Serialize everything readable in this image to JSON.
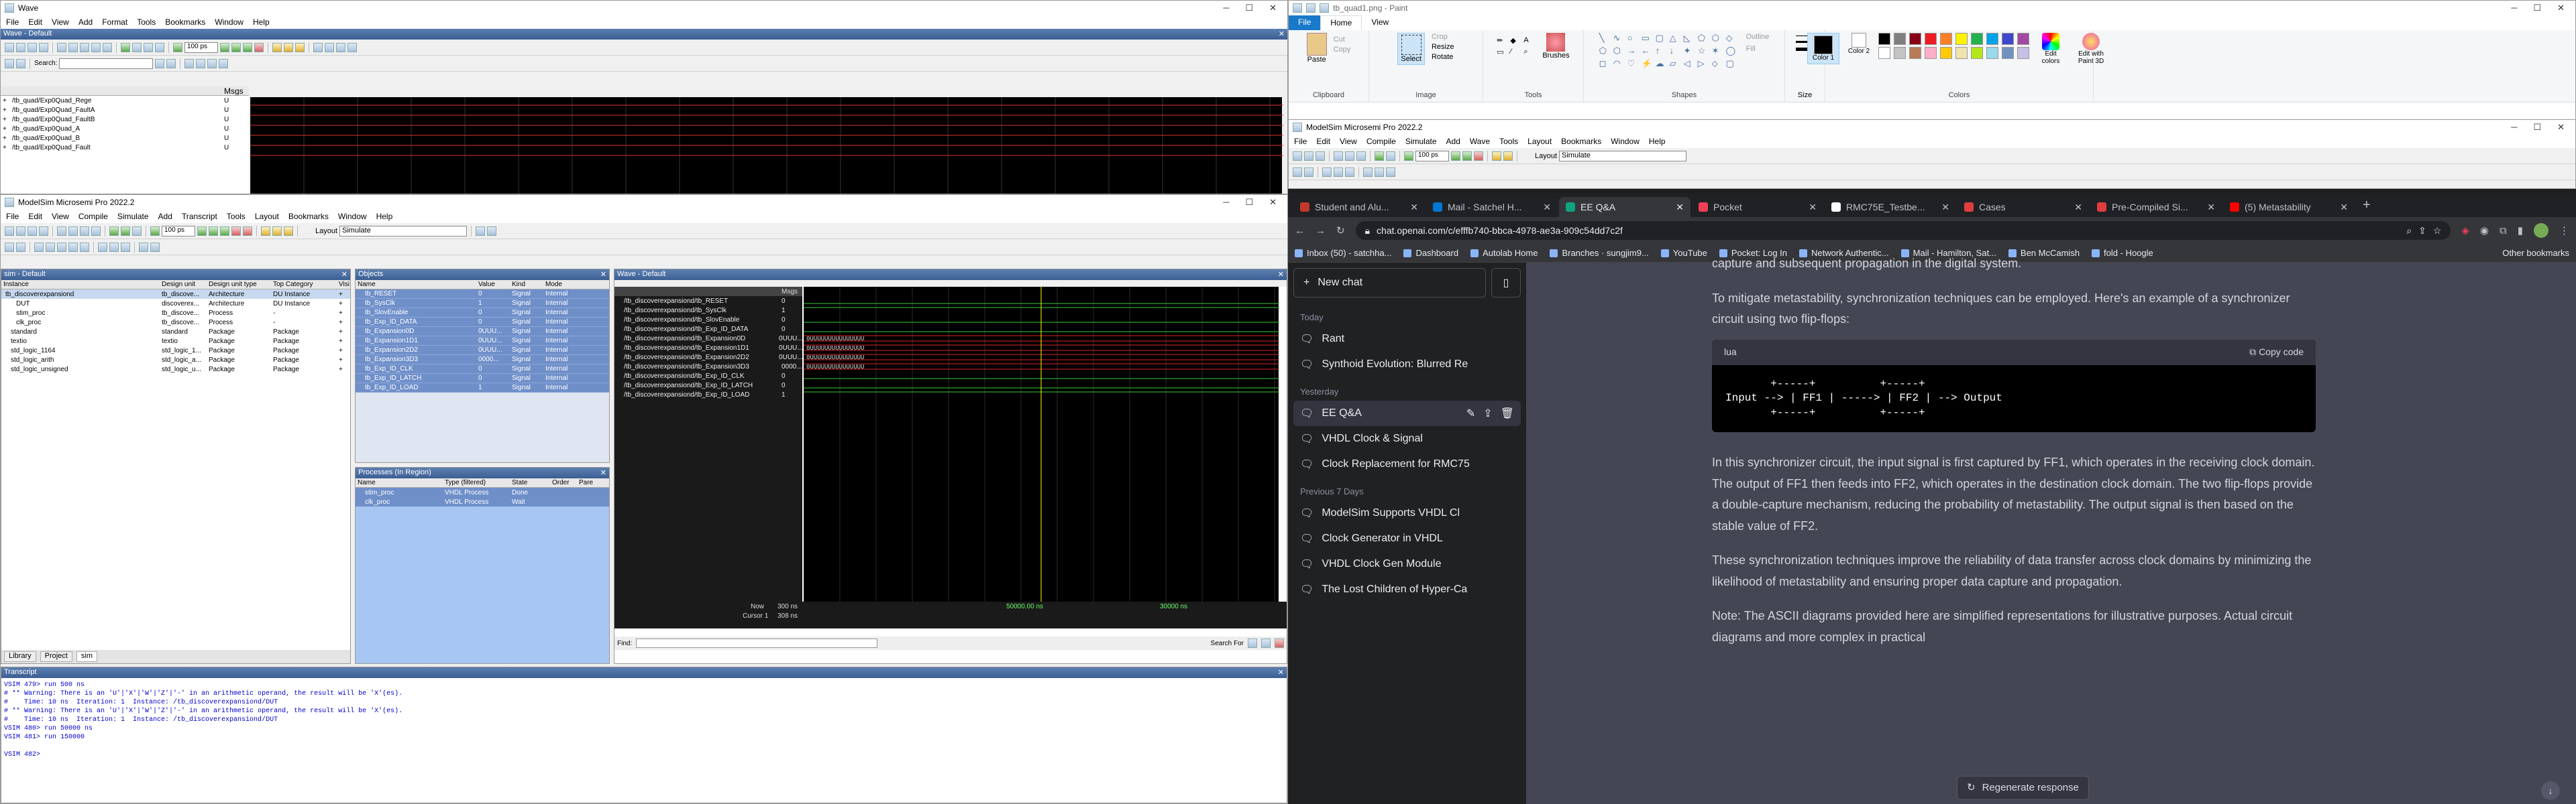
{
  "wave_window": {
    "title": "Wave",
    "menu": [
      "File",
      "Edit",
      "View",
      "Add",
      "Format",
      "Tools",
      "Bookmarks",
      "Window",
      "Help"
    ],
    "panel_title": "Wave - Default",
    "search_label": "Search:",
    "msgs_header": "Msgs",
    "signals": [
      {
        "name": "/tb_quad/Exp0Quad_Rege",
        "value": "U"
      },
      {
        "name": "/tb_quad/Exp0Quad_FaultA",
        "value": "U"
      },
      {
        "name": "/tb_quad/Exp0Quad_FaultB",
        "value": "U"
      },
      {
        "name": "/tb_quad/Exp0Quad_A",
        "value": "U"
      },
      {
        "name": "/tb_quad/Exp0Quad_B",
        "value": "U"
      },
      {
        "name": "/tb_quad/Exp0Quad_Fault",
        "value": "U"
      }
    ],
    "zoom_value": "100 ps"
  },
  "modelsim_left": {
    "title": "ModelSim Microsemi Pro 2022.2",
    "menu": [
      "File",
      "Edit",
      "View",
      "Compile",
      "Simulate",
      "Add",
      "Transcript",
      "Tools",
      "Layout",
      "Bookmarks",
      "Window",
      "Help"
    ],
    "layout_label": "Layout",
    "layout_value": "Simulate",
    "zoom_value": "100 ps",
    "sim_panel": {
      "title": "sim - Default",
      "columns": [
        "Instance",
        "Design unit",
        "Design unit type",
        "Top Category",
        "Visi"
      ],
      "rows": [
        [
          "tb_discoverexpansiond",
          "tb_discove...",
          "Architecture",
          "DU Instance",
          "+"
        ],
        [
          "DUT",
          "discoverex...",
          "Architecture",
          "DU Instance",
          "+"
        ],
        [
          "stim_proc",
          "tb_discove...",
          "Process",
          "-",
          "+"
        ],
        [
          "clk_proc",
          "tb_discove...",
          "Process",
          "-",
          "+"
        ],
        [
          "standard",
          "standard",
          "Package",
          "Package",
          "+"
        ],
        [
          "textio",
          "textio",
          "Package",
          "Package",
          "+"
        ],
        [
          "std_logic_1164",
          "std_logic_1...",
          "Package",
          "Package",
          "+"
        ],
        [
          "std_logic_arith",
          "std_logic_a...",
          "Package",
          "Package",
          "+"
        ],
        [
          "std_logic_unsigned",
          "std_logic_u...",
          "Package",
          "Package",
          "+"
        ]
      ],
      "tabs": [
        "Library",
        "Project",
        "sim"
      ]
    },
    "objects_panel": {
      "title": "Objects",
      "columns": [
        "Name",
        "Value",
        "Kind",
        "Mode"
      ],
      "rows": [
        [
          "tb_RESET",
          "0",
          "Signal",
          "Internal"
        ],
        [
          "tb_SysClk",
          "1",
          "Signal",
          "Internal"
        ],
        [
          "tb_SlovEnable",
          "0",
          "Signal",
          "Internal"
        ],
        [
          "tb_Exp_ID_DATA",
          "0",
          "Signal",
          "Internal"
        ],
        [
          "tb_Expansion0D",
          "0UUU...",
          "Signal",
          "Internal"
        ],
        [
          "tb_Expansion1D1",
          "0UUU...",
          "Signal",
          "Internal"
        ],
        [
          "tb_Expansion2D2",
          "0UUU...",
          "Signal",
          "Internal"
        ],
        [
          "tb_Expansion3D3",
          "0000...",
          "Signal",
          "Internal"
        ],
        [
          "tb_Exp_ID_CLK",
          "0",
          "Signal",
          "Internal"
        ],
        [
          "tb_Exp_ID_LATCH",
          "0",
          "Signal",
          "Internal"
        ],
        [
          "tb_Exp_ID_LOAD",
          "1",
          "Signal",
          "Internal"
        ]
      ]
    },
    "processes_panel": {
      "title": "Processes (In Region)",
      "columns": [
        "Name",
        "Type (filtered)",
        "State",
        "Order",
        "Pare"
      ],
      "rows": [
        [
          "stim_proc",
          "VHDL Process",
          "Done",
          "",
          ""
        ],
        [
          "clk_proc",
          "VHDL Process",
          "Wait",
          "",
          ""
        ]
      ]
    },
    "wave_panel": {
      "title": "Wave - Default",
      "msgs_header": "Msgs",
      "signals": [
        {
          "name": "/tb_discoverexpansiond/tb_RESET",
          "value": "0"
        },
        {
          "name": "/tb_discoverexpansiond/tb_SysClk",
          "value": "1"
        },
        {
          "name": "/tb_discoverexpansiond/tb_SlovEnable",
          "value": "0"
        },
        {
          "name": "/tb_discoverexpansiond/tb_Exp_ID_DATA",
          "value": "0"
        },
        {
          "name": "/tb_discoverexpansiond/tb_Expansion0D",
          "value": "0UUU..."
        },
        {
          "name": "/tb_discoverexpansiond/tb_Expansion1D1",
          "value": "0UUU..."
        },
        {
          "name": "/tb_discoverexpansiond/tb_Expansion2D2",
          "value": "0UUU..."
        },
        {
          "name": "/tb_discoverexpansiond/tb_Expansion3D3",
          "value": "0000..."
        },
        {
          "name": "/tb_discoverexpansiond/tb_Exp_ID_CLK",
          "value": "0"
        },
        {
          "name": "/tb_discoverexpansiond/tb_Exp_ID_LATCH",
          "value": "0"
        },
        {
          "name": "/tb_discoverexpansiond/tb_Exp_ID_LOAD",
          "value": "1"
        }
      ],
      "bus_text": "0UUUUUUUUUUUUUUU",
      "now_label": "Now",
      "now_value": "300 ns",
      "cursor_label": "Cursor 1",
      "cursor_value": "308 ns",
      "time_marks": [
        "50000.00 ns",
        "30000 ns"
      ],
      "find_label": "Find:",
      "search_for": "Search For"
    },
    "transcript": {
      "title": "Transcript",
      "lines": [
        "VSIM 479> run 500 ns",
        "# ** Warning: There is an 'U'|'X'|'W'|'Z'|'-' in an arithmetic operand, the result will be 'X'(es).",
        "#    Time: 10 ns  Iteration: 1  Instance: /tb_discoverexpansiond/DUT",
        "# ** Warning: There is an 'U'|'X'|'W'|'Z'|'-' in an arithmetic operand, the result will be 'X'(es).",
        "#    Time: 10 ns  Iteration: 1  Instance: /tb_discoverexpansiond/DUT",
        "VSIM 480> run 50000 ns",
        "VSIM 481> run 150000",
        "",
        "VSIM 482>"
      ]
    }
  },
  "paint": {
    "title": "tb_quad1.png - Paint",
    "tabs": [
      "File",
      "Home",
      "View"
    ],
    "groups": [
      "Clipboard",
      "Image",
      "Tools",
      "Shapes",
      "Colors"
    ],
    "clipboard": {
      "paste": "Paste",
      "cut": "Cut",
      "copy": "Copy"
    },
    "image": {
      "select": "Select",
      "crop": "Crop",
      "resize": "Resize",
      "rotate": "Rotate"
    },
    "tools": {
      "brushes": "Brushes"
    },
    "shapes": {
      "outline": "Outline",
      "fill": "Fill"
    },
    "size_label": "Size",
    "color1_label": "Color 1",
    "color2_label": "Color 2",
    "edit_colors": "Edit colors",
    "edit_paint3d": "Edit with Paint 3D",
    "palette": [
      "#000000",
      "#7f7f7f",
      "#880015",
      "#ed1c24",
      "#ff7f27",
      "#fff200",
      "#22b14c",
      "#00a2e8",
      "#3f48cc",
      "#a349a4",
      "#ffffff",
      "#c3c3c3",
      "#b97a57",
      "#ffaec9",
      "#ffc90e",
      "#efe4b0",
      "#b5e61d",
      "#99d9ea",
      "#7092be",
      "#c8bfe7"
    ]
  },
  "modelsim_right": {
    "title": "ModelSim Microsemi Pro 2022.2",
    "menu": [
      "File",
      "Edit",
      "View",
      "Compile",
      "Simulate",
      "Add",
      "Wave",
      "Tools",
      "Layout",
      "Bookmarks",
      "Window",
      "Help"
    ],
    "layout_label": "Layout",
    "layout_value": "Simulate",
    "zoom_value": "100 ps"
  },
  "chrome": {
    "tabs": [
      {
        "label": "Student and Alu...",
        "color": "#c0392b"
      },
      {
        "label": "Mail - Satchel H...",
        "color": "#0078d4"
      },
      {
        "label": "EE Q&A",
        "color": "#10a37f",
        "active": true
      },
      {
        "label": "Pocket",
        "color": "#ef4056"
      },
      {
        "label": "RMC75E_Testbe...",
        "color": "#ffffff"
      },
      {
        "label": "Cases",
        "color": "#e03e3e"
      },
      {
        "label": "Pre-Compiled Si...",
        "color": "#e03e3e"
      },
      {
        "label": "(5) Metastability",
        "color": "#ff0000"
      }
    ],
    "url": "chat.openai.com/c/efffb740-bbca-4978-ae3a-909c54dd7c2f",
    "bookmarks": [
      "Inbox (50) - satchha...",
      "Dashboard",
      "Autolab Home",
      "Branches · sungjim9...",
      "YouTube",
      "Pocket: Log In",
      "Network Authentic...",
      "Mail - Hamilton, Sat...",
      "Ben McCamish",
      "fold - Hoogle"
    ],
    "other_bookmarks": "Other bookmarks"
  },
  "chat": {
    "new_chat": "New chat",
    "sections": [
      {
        "header": "Today",
        "items": [
          "Rant",
          "Synthoid Evolution: Blurred Re"
        ]
      },
      {
        "header": "Yesterday",
        "items": [
          "EE Q&A",
          "VHDL Clock & Signal",
          "Clock Replacement for RMC75"
        ]
      },
      {
        "header": "Previous 7 Days",
        "items": [
          "ModelSim Supports VHDL Cl",
          "Clock Generator in VHDL",
          "VHDL Clock Gen Module",
          "The Lost Children of Hyper-Ca"
        ]
      }
    ],
    "active_item": "EE Q&A",
    "para_top": "capture and subsequent propagation in the digital system.",
    "para_intro": "To mitigate metastability, synchronization techniques can be employed. Here's an example of a synchronizer circuit using two flip-flops:",
    "code_lang": "lua",
    "copy_code": "Copy code",
    "code": "       +-----+          +-----+\nInput --> | FF1 | -----> | FF2 | --> Output\n       +-----+          +-----+",
    "para_1": "In this synchronizer circuit, the input signal is first captured by FF1, which operates in the receiving clock domain. The output of FF1 then feeds into FF2, which operates in the destination clock domain. The two flip-flops provide a double-capture mechanism, reducing the probability of metastability. The output signal is then based on the stable value of FF2.",
    "para_2": "These synchronization techniques improve the reliability of data transfer across clock domains by minimizing the likelihood of metastability and ensuring proper data capture and propagation.",
    "para_3": "Note: The ASCII diagrams provided here are simplified representations for illustrative purposes. Actual circuit diagrams and more complex in practical",
    "regenerate": "Regenerate response"
  }
}
